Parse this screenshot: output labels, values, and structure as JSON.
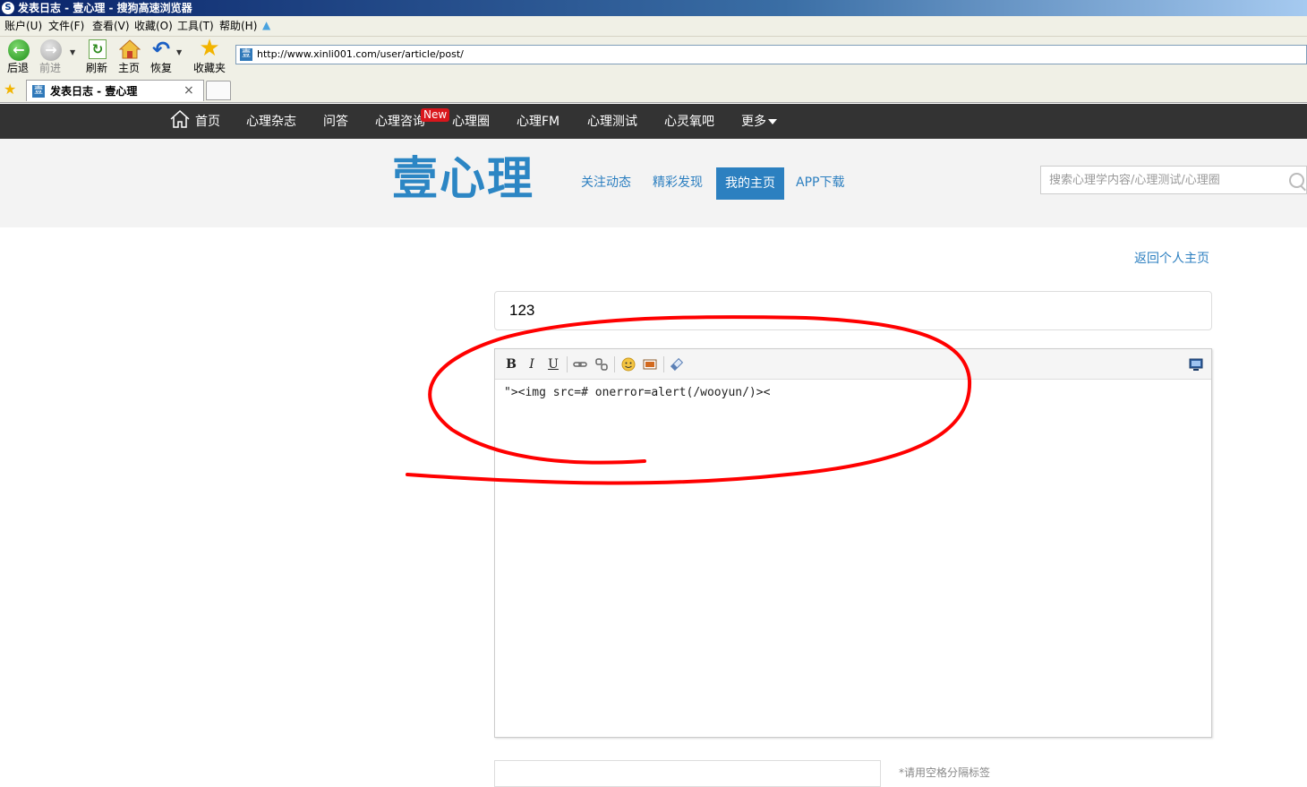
{
  "browser": {
    "window_title": "发表日志 - 壹心理 - 搜狗高速浏览器",
    "menu": [
      "账户(U)",
      "文件(F)",
      "查看(V)",
      "收藏(O)",
      "工具(T)",
      "帮助(H)"
    ],
    "toolbar": {
      "back": "后退",
      "forward": "前进",
      "refresh": "刷新",
      "home": "主页",
      "restore": "恢复",
      "favorites": "收藏夹"
    },
    "url": "http://www.xinli001.com/user/article/post/",
    "tab_title": "发表日志 - 壹心理",
    "tab_close": "×",
    "favicon_glyph": "壹"
  },
  "site": {
    "nav": [
      "首页",
      "心理杂志",
      "问答",
      "心理咨询",
      "心理圈",
      "心理FM",
      "心理测试",
      "心灵氧吧",
      "更多"
    ],
    "new_badge": "New",
    "logo": "壹心理",
    "header_links": [
      "关注动态",
      "精彩发现",
      "我的主页",
      "APP下载"
    ],
    "search_placeholder": "搜索心理学内容/心理测试/心理圈",
    "back_link": "返回个人主页",
    "title_value": "123",
    "editor": {
      "buttons": [
        "B",
        "I",
        "U"
      ],
      "content": "\"><img src=# onerror=alert(/wooyun/)><"
    },
    "bottom_hint": "*请用空格分隔标签"
  },
  "colors": {
    "brand": "#2c86c4",
    "nav_bg": "#333333",
    "annotation": "#ff0000"
  }
}
